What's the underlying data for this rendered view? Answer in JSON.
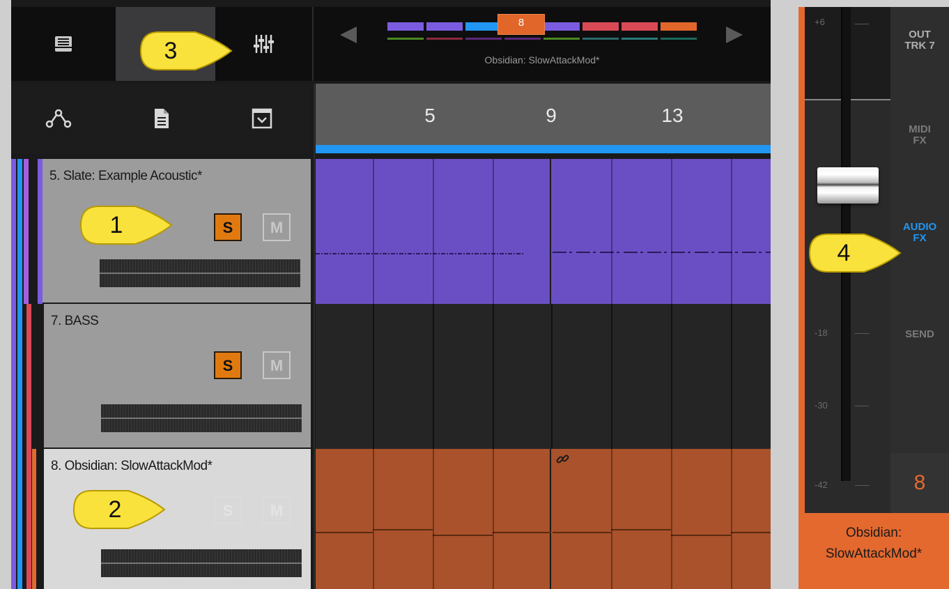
{
  "toolbar": {
    "browser_icon": "inbox-icon",
    "mixer_icon": "mixer-sliders-icon",
    "automation_icon": "nodes-icon",
    "document_icon": "document-icon",
    "dropdown_icon": "dropdown-box-icon"
  },
  "navigator": {
    "selected_track_number": "8",
    "title": "Obsidian: SlowAttackMod*",
    "segments": [
      "#7b5ce0",
      "#7b5ce0",
      "#2196f3",
      "#e0662a",
      "#7b5ce0",
      "#d94a56",
      "#d94a56",
      "#e0662a"
    ],
    "sub_segments": [
      "#4a8a20",
      "#8a2a40",
      "#5a2a7a",
      "#5a2a7a",
      "#4a8a20",
      "#2a6a6a",
      "#2a7a7a",
      "#1a6a5a"
    ]
  },
  "timeline": {
    "bar_numbers": [
      "5",
      "9",
      "13"
    ]
  },
  "tracks": [
    {
      "name": "5. Slate: Example Acoustic*",
      "solo_label": "S",
      "mute_label": "M",
      "solo_on": true,
      "color": "#6a4fc4"
    },
    {
      "name": "7. BASS",
      "solo_label": "S",
      "mute_label": "M",
      "solo_on": true,
      "color": "#d94a56"
    },
    {
      "name": "8. Obsidian: SlowAttackMod*",
      "solo_label": "S",
      "mute_label": "M",
      "solo_on": false,
      "color": "#a9522b"
    }
  ],
  "mixer": {
    "db_labels": [
      "+6",
      "-18",
      "-30",
      "-42"
    ],
    "tabs": {
      "out": "OUT\nTRK 7",
      "midi_fx": "MIDI\nFX",
      "audio_fx": "AUDIO\nFX",
      "send": "SEND"
    },
    "track_number": "8",
    "track_label_line1": "Obsidian:",
    "track_label_line2": "SlowAttackMod*"
  },
  "callouts": [
    "1",
    "2",
    "3",
    "4"
  ],
  "colors": {
    "accent": "#e3692f",
    "selection": "#2196f3",
    "solo_on": "#e07a10"
  }
}
